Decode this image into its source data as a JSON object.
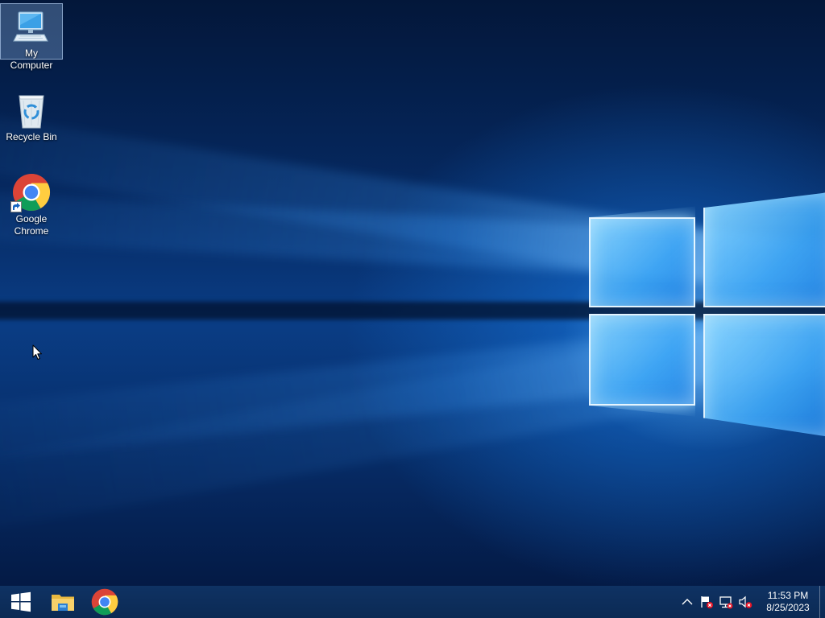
{
  "desktop": {
    "icons": [
      {
        "label": "My Computer",
        "icon": "computer-icon",
        "selected": true
      },
      {
        "label": "Recycle Bin",
        "icon": "recycle-bin-icon",
        "selected": false
      },
      {
        "label": "Google Chrome",
        "icon": "chrome-icon",
        "selected": false,
        "shortcut": true
      }
    ]
  },
  "taskbar": {
    "pinned": [
      {
        "name": "start-button",
        "icon": "windows-logo-icon"
      },
      {
        "name": "file-explorer",
        "icon": "folder-icon"
      },
      {
        "name": "google-chrome",
        "icon": "chrome-icon"
      }
    ],
    "tray": {
      "icons": [
        "chevron-up-icon",
        "action-center-flag-icon",
        "network-icon",
        "volume-muted-icon"
      ],
      "time": "11:53 PM",
      "date": "8/25/2023"
    }
  },
  "colors": {
    "taskbar": "#0b2a54",
    "wallpaper_dark": "#03173a",
    "wallpaper_light": "#3aa5f5",
    "error_red": "#e81123"
  }
}
